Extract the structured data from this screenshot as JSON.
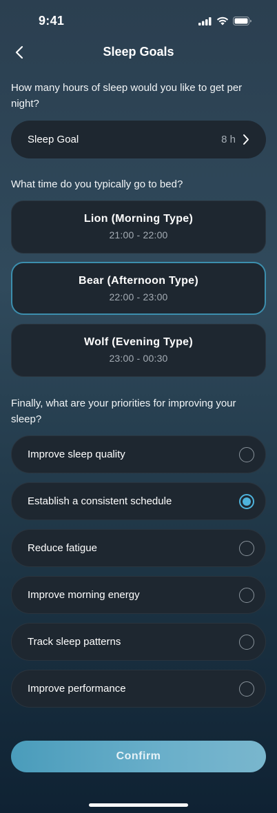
{
  "status_bar": {
    "time": "9:41"
  },
  "header": {
    "title": "Sleep Goals"
  },
  "sleep_goal": {
    "question": "How many hours of sleep would you like to get per night?",
    "label": "Sleep Goal",
    "value": "8 h"
  },
  "bedtime": {
    "question": "What time do you typically go to bed?",
    "options": [
      {
        "name": "Lion (Morning Type)",
        "time": "21:00 - 22:00",
        "selected": false
      },
      {
        "name": "Bear (Afternoon Type)",
        "time": "22:00 - 23:00",
        "selected": true
      },
      {
        "name": "Wolf (Evening Type)",
        "time": "23:00 - 00:30",
        "selected": false
      }
    ]
  },
  "priorities": {
    "question": "Finally, what are your priorities for improving your sleep?",
    "items": [
      {
        "label": "Improve sleep quality",
        "checked": false
      },
      {
        "label": "Establish a consistent schedule",
        "checked": true
      },
      {
        "label": "Reduce fatigue",
        "checked": false
      },
      {
        "label": "Improve morning energy",
        "checked": false
      },
      {
        "label": "Track sleep patterns",
        "checked": false
      },
      {
        "label": "Improve performance",
        "checked": false
      }
    ]
  },
  "confirm": {
    "label": "Confirm"
  },
  "colors": {
    "accent": "#4eb3dc",
    "card": "#1e2730",
    "selected_border": "#3c8fae"
  }
}
